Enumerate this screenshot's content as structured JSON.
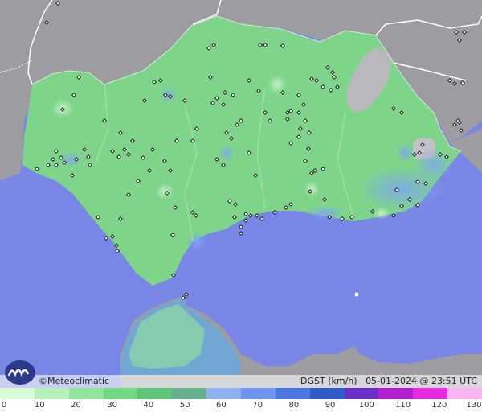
{
  "credit": "©Meteoclimatic",
  "caption": {
    "variable": "DGST (km/h)",
    "datetime": "05-01-2024 @ 23:51 UTC"
  },
  "legend": {
    "ticks": [
      "0",
      "10",
      "20",
      "30",
      "40",
      "50",
      "60",
      "70",
      "80",
      "90",
      "100",
      "110",
      "120",
      "130"
    ],
    "colors": [
      "#d8fbd8",
      "#b6f1ba",
      "#8fe69a",
      "#6fd983",
      "#5ec579",
      "#66b08c",
      "#8fb0ee",
      "#6e96ee",
      "#4a78e0",
      "#2f5cc9",
      "#6a2fc7",
      "#b21fd0",
      "#e62ae0",
      "#f7b6f2"
    ]
  },
  "colors": {
    "sea": "#7a86e6",
    "land_outside": "#9a9a9f",
    "andalusia": "#7ed58a",
    "morocco_land": "#6fa8d8",
    "station_marker": "#111111"
  }
}
